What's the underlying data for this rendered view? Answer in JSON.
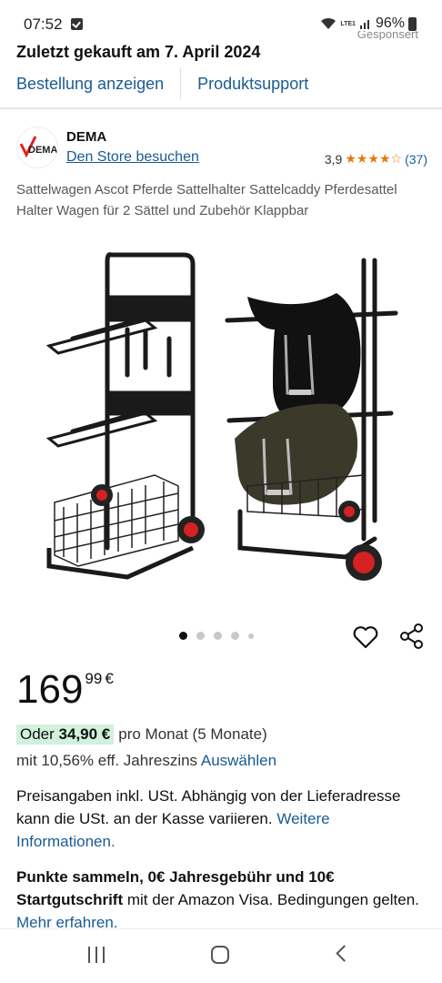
{
  "status_bar": {
    "time": "07:52",
    "network": "LTE1",
    "battery": "96%"
  },
  "sponsored": "Gesponsert",
  "order": {
    "title": "Zuletzt gekauft am 7. April 2024",
    "show_order": "Bestellung anzeigen",
    "product_support": "Produktsupport"
  },
  "brand": {
    "name": "DEMA",
    "logo_text": "DEMA",
    "store_link": "Den Store besuchen",
    "rating_value": "3,9",
    "stars": "★★★★☆",
    "rating_count": "(37)"
  },
  "product": {
    "title": "Sattelwagen Ascot Pferde Sattelhalter Sattelcaddy Pferdesattel Halter Wagen für 2 Sättel und Zubehör Klappbar",
    "image_count": 5,
    "active_image": 1
  },
  "price": {
    "whole": "169",
    "fraction": "99",
    "currency": "€"
  },
  "financing": {
    "prefix": "Oder",
    "amount": "34,90 €",
    "suffix": "pro Monat (5 Monate)",
    "apr_text": "mit 10,56% eff. Jahreszins",
    "apr_link": "Auswählen"
  },
  "tax": {
    "text": "Preisangaben inkl. USt. Abhängig von der Lieferadresse kann die USt. an der Kasse variieren.",
    "link": "Weitere Informationen."
  },
  "promo": {
    "bold": "Punkte sammeln, 0€ Jahresgebühr und 10€ Startgutschrift",
    "text": "mit der Amazon Visa. Bedingungen gelten.",
    "link": "Mehr erfahren."
  },
  "icons": {
    "heart": "heart-icon",
    "share": "share-icon",
    "nav_recent": "recent-apps-icon",
    "nav_home": "home-icon",
    "nav_back": "back-icon"
  },
  "colors": {
    "link": "#1a5b93",
    "star": "#E47911",
    "badge_bg": "#d2f0dc",
    "text": "#0F1111"
  }
}
